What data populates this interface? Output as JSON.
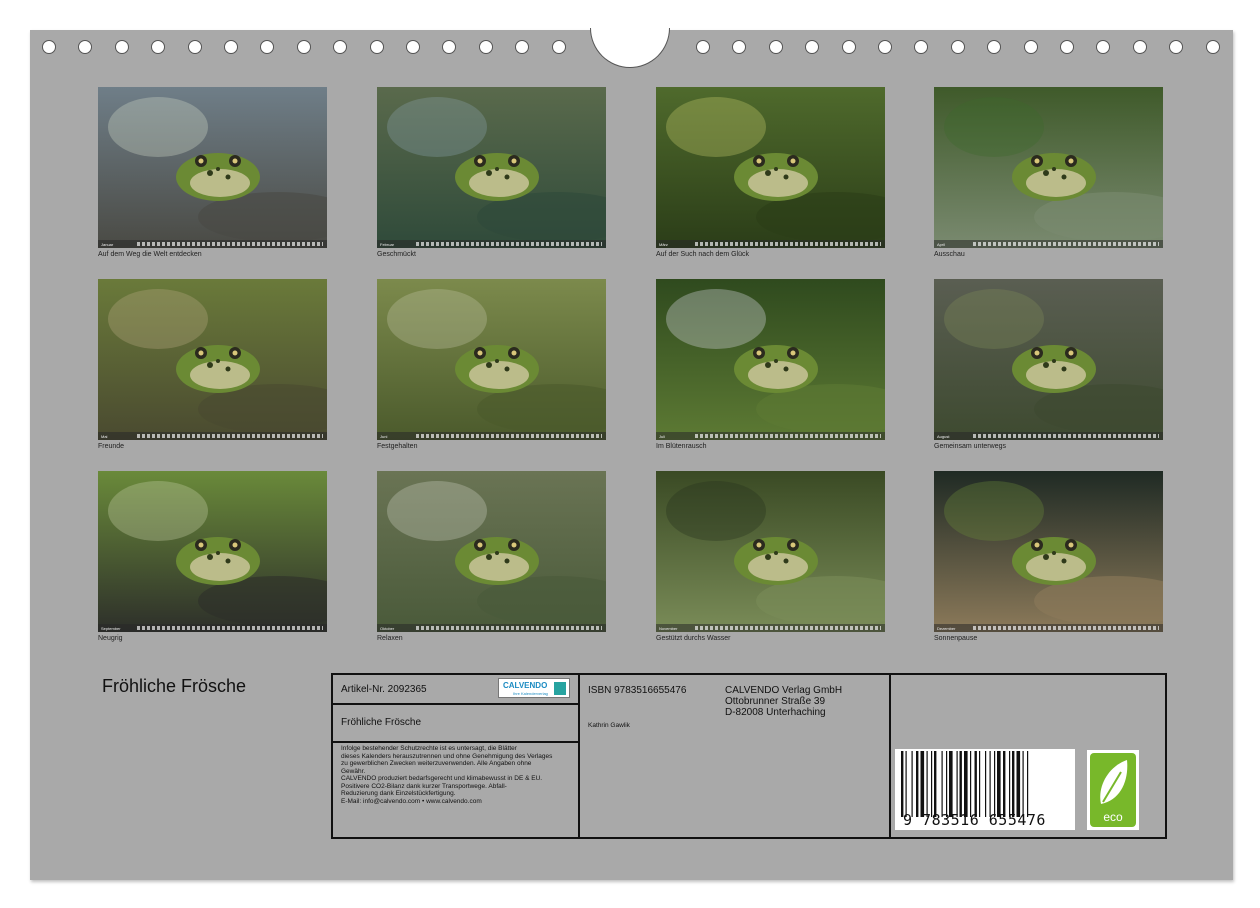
{
  "months": [
    {
      "caption": "Auf dem Weg die Welt entdecken",
      "month": "Januar",
      "colors": [
        "#6f7e88",
        "#4a4a44",
        "#cfd6c6"
      ]
    },
    {
      "caption": "Geschmückt",
      "month": "Februar",
      "colors": [
        "#5a6a4c",
        "#2f4a3a",
        "#8aa0a8"
      ]
    },
    {
      "caption": "Auf der Such nach dem Glück",
      "month": "März",
      "colors": [
        "#4f6a2c",
        "#2b3d18",
        "#c2c86a"
      ]
    },
    {
      "caption": "Ausschau",
      "month": "April",
      "colors": [
        "#3f5a2a",
        "#7a8a70",
        "#3d6b2a"
      ]
    },
    {
      "caption": "Freunde",
      "month": "Mai",
      "colors": [
        "#6a7a3a",
        "#4a4a30",
        "#b7a882"
      ]
    },
    {
      "caption": "Festgehalten",
      "month": "Juni",
      "colors": [
        "#7c8a4c",
        "#4b5a2c",
        "#bfc4a2"
      ]
    },
    {
      "caption": "Im Blütenrausch",
      "month": "Juli",
      "colors": [
        "#2f4a1e",
        "#5d7a34",
        "#d9dbe4"
      ]
    },
    {
      "caption": "Gemeinsam unterwegs",
      "month": "August",
      "colors": [
        "#5a5e52",
        "#3e4a30",
        "#7e8a5a"
      ]
    },
    {
      "caption": "Neugrig",
      "month": "September",
      "colors": [
        "#6a8a3a",
        "#2d2f2a",
        "#c5cfa6"
      ]
    },
    {
      "caption": "Relaxen",
      "month": "Oktober",
      "colors": [
        "#6a7454",
        "#4a5a3a",
        "#c8cbbd"
      ]
    },
    {
      "caption": "Gestützt durchs Wasser",
      "month": "November",
      "colors": [
        "#3a4a24",
        "#7a8c58",
        "#26301e"
      ]
    },
    {
      "caption": "Sonnenpause",
      "month": "Dezember",
      "colors": [
        "#1f2a24",
        "#8c7a5a",
        "#6a8a3a"
      ]
    }
  ],
  "calendar_title": "Fröhliche Frösche",
  "info": {
    "article": "Artikel-Nr. 2092365",
    "logo_word": "CALVENDO",
    "logo_sub": "Ihre Kalenderverlag",
    "book_title": "Fröhliche Frösche",
    "legal": [
      "Infolge bestehender Schutzrechte ist es untersagt, die Blätter",
      "dieses Kalenders herauszutrennen und ohne Genehmigung des Verlages",
      "zu gewerblichen Zwecken weiterzuverwenden. Alle Angaben ohne",
      "Gewähr.",
      "CALVENDO produziert bedarfsgerecht und klimabewusst in DE & EU.",
      "Positivere CO2-Bilanz dank kurzer Transportwege. Abfall-",
      "Reduzierung dank Einzelstückfertigung.",
      "E-Mail: info@calvendo.com • www.calvendo.com"
    ],
    "isbn": "ISBN 9783516655476",
    "author": "Kathrin Gawlik",
    "publisher": [
      "CALVENDO Verlag GmbH",
      "Ottobrunner Straße 39",
      "D-82008 Unterhaching"
    ],
    "barcode_digits": "9 783516 655476",
    "eco_label": "eco"
  }
}
